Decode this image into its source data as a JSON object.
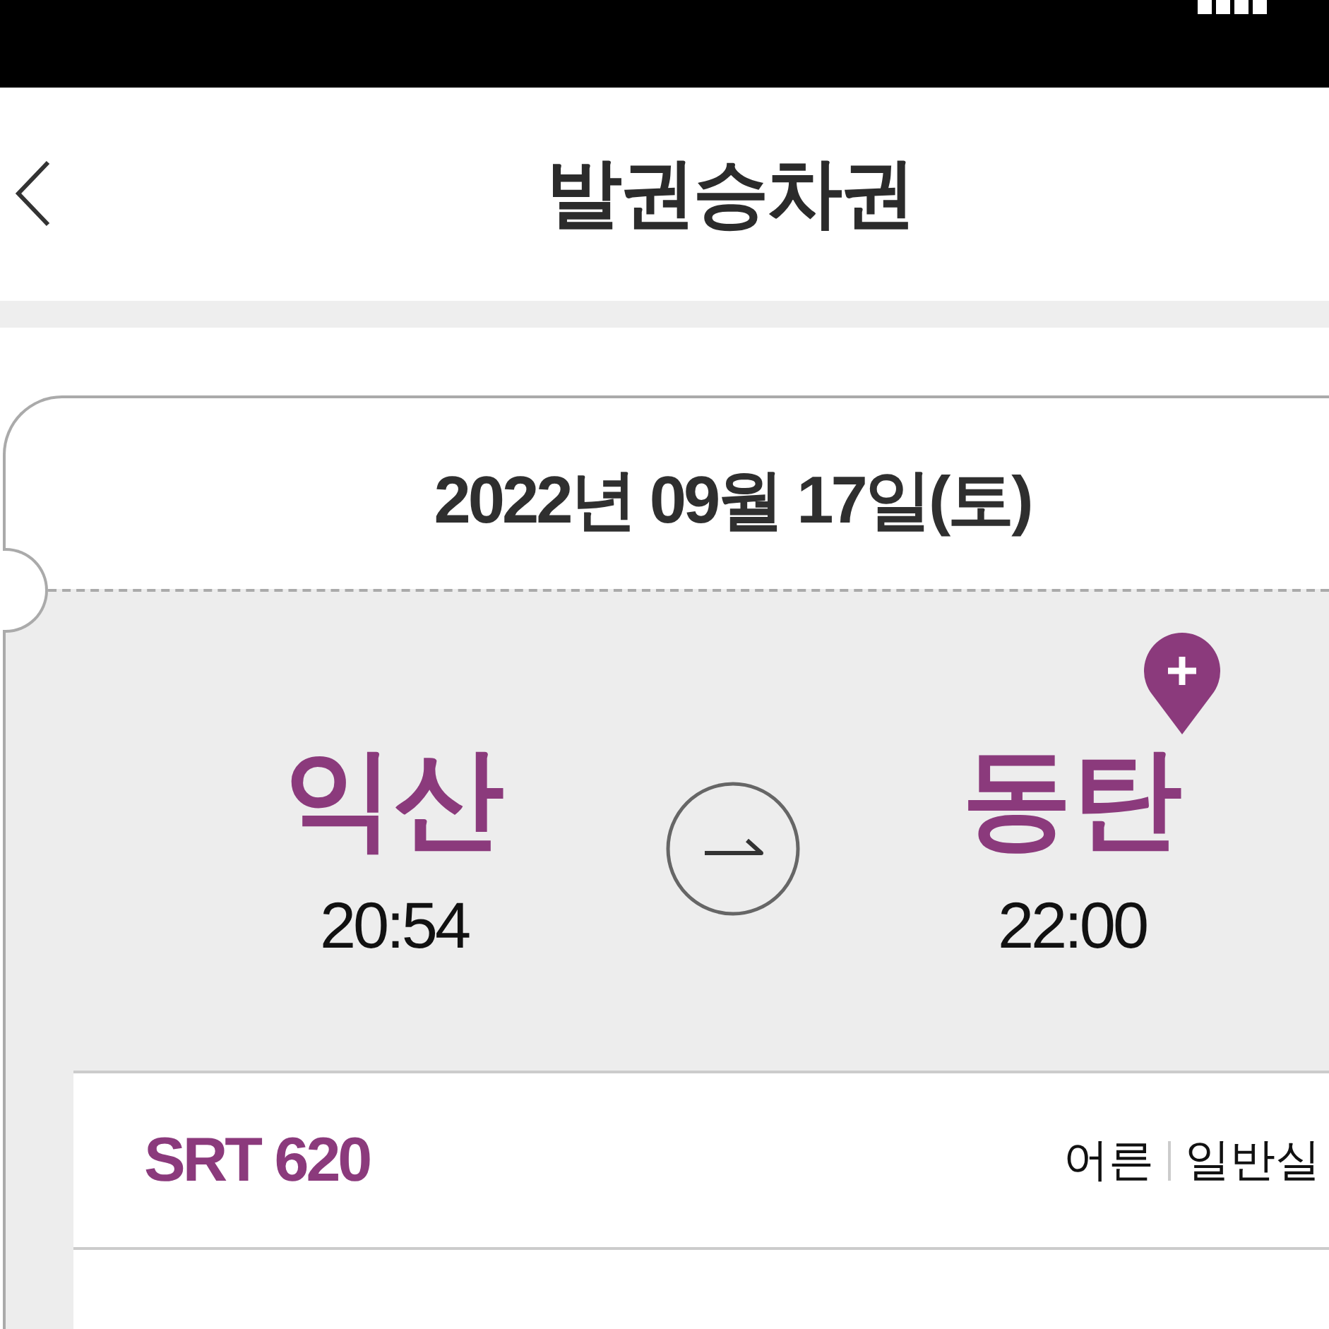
{
  "header": {
    "title": "발권승차권"
  },
  "ticket": {
    "date": "2022년 09월 17일(토)",
    "departure": {
      "station": "익산",
      "time": "20:54"
    },
    "arrival": {
      "station": "동탄",
      "time": "22:00"
    },
    "train": "SRT 620",
    "passenger_type": "어른",
    "seat_class": "일반실"
  }
}
